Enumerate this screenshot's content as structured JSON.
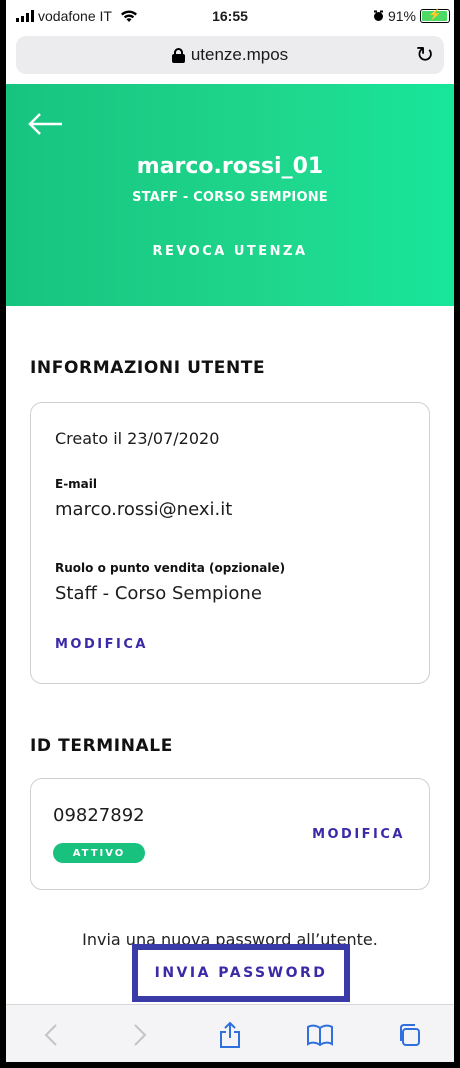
{
  "status_bar": {
    "carrier": "vodafone IT",
    "time": "16:55",
    "battery": "91%",
    "battery_level": 0.91
  },
  "browser": {
    "url": "utenze.mpos"
  },
  "header": {
    "username": "marco.rossi_01",
    "subtitle": "STAFF - CORSO SEMPIONE",
    "revoke_label": "REVOCA UTENZA",
    "accent_color": "#1fd68c"
  },
  "user_info": {
    "section_title": "INFORMAZIONI UTENTE",
    "created": "Creato il 23/07/2020",
    "email_label": "E-mail",
    "email_value": "marco.rossi@nexi.it",
    "role_label": "Ruolo o punto vendita (opzionale)",
    "role_value": "Staff - Corso Sempione",
    "edit_label": "MODIFICA"
  },
  "terminal": {
    "section_title": "ID TERMINALE",
    "id": "09827892",
    "status": "ATTIVO",
    "edit_label": "MODIFICA"
  },
  "password": {
    "info": "Invia una nuova password all’utente.",
    "send_label": "INVIA PASSWORD"
  },
  "toolbar": {
    "icons": [
      "back-icon",
      "forward-icon",
      "share-icon",
      "bookmarks-icon",
      "tabs-icon"
    ]
  }
}
